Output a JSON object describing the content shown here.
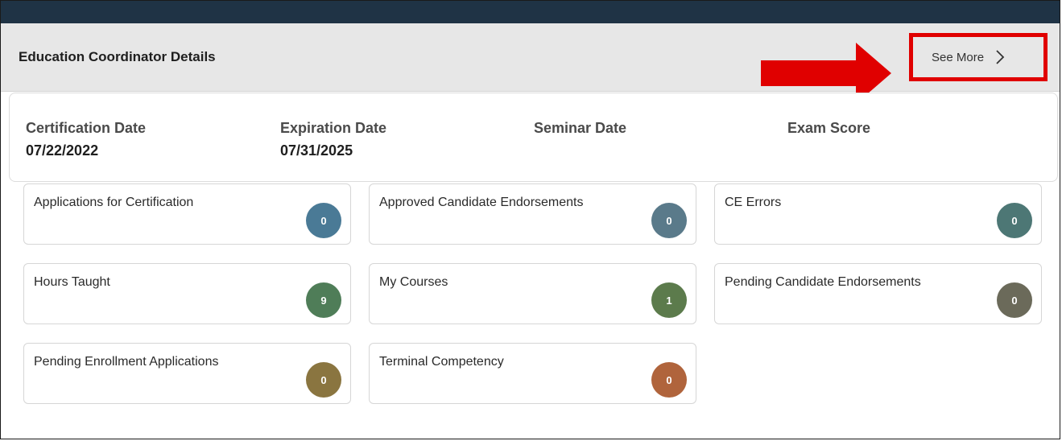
{
  "header": {
    "title": "Education Coordinator Details",
    "see_more_label": "See More"
  },
  "annotation": {
    "arrow_color": "#e00000",
    "highlight_color": "#e00000"
  },
  "certification": {
    "fields": [
      {
        "label": "Certification Date",
        "value": "07/22/2022"
      },
      {
        "label": "Expiration Date",
        "value": "07/31/2025"
      },
      {
        "label": "Seminar Date",
        "value": ""
      },
      {
        "label": "Exam Score",
        "value": ""
      }
    ]
  },
  "tiles": [
    {
      "label": "Applications for Certification",
      "count": "0",
      "badge_color": "#4a7a96"
    },
    {
      "label": "Approved Candidate Endorsements",
      "count": "0",
      "badge_color": "#5a7a8a"
    },
    {
      "label": "CE Errors",
      "count": "0",
      "badge_color": "#4d7775"
    },
    {
      "label": "Hours Taught",
      "count": "9",
      "badge_color": "#4f7d58"
    },
    {
      "label": "My Courses",
      "count": "1",
      "badge_color": "#5c7b4c"
    },
    {
      "label": "Pending Candidate Endorsements",
      "count": "0",
      "badge_color": "#6b6a5a"
    },
    {
      "label": "Pending Enrollment Applications",
      "count": "0",
      "badge_color": "#8a7540"
    },
    {
      "label": "Terminal Competency",
      "count": "0",
      "badge_color": "#b0643c"
    }
  ]
}
